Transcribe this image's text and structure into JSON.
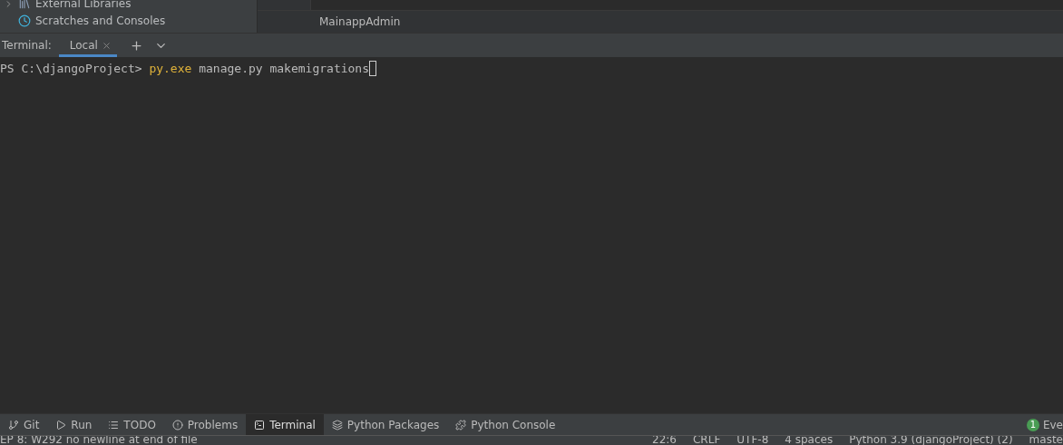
{
  "project_tree": {
    "items": [
      {
        "label": "External Libraries",
        "kind": "library"
      },
      {
        "label": "Scratches and Consoles",
        "kind": "scratch"
      }
    ]
  },
  "editor": {
    "breadcrumb": "MainappAdmin"
  },
  "terminal": {
    "title": "Terminal:",
    "tabs": [
      {
        "label": "Local",
        "selected": true
      }
    ],
    "prompt": "PS C:\\djangoProject>",
    "command": "py.exe",
    "args": "manage.py makemigrations"
  },
  "tool_bar": {
    "tabs": [
      {
        "label": "Git",
        "kind": "git",
        "selected": false
      },
      {
        "label": "Run",
        "kind": "run",
        "selected": false
      },
      {
        "label": "TODO",
        "kind": "todo",
        "selected": false
      },
      {
        "label": "Problems",
        "kind": "problems",
        "selected": false
      },
      {
        "label": "Terminal",
        "kind": "terminal",
        "selected": true
      },
      {
        "label": "Python Packages",
        "kind": "packages",
        "selected": false
      },
      {
        "label": "Python Console",
        "kind": "console",
        "selected": false
      }
    ],
    "event_count": "1",
    "event_label": "Eve"
  },
  "status_bar": {
    "message": "EP 8: W292 no newline at end of file",
    "items": [
      "22:6",
      "CRLF",
      "UTF-8",
      "4 spaces",
      "Python 3.9 (djangoProject) (2)"
    ],
    "branch": "maste"
  }
}
